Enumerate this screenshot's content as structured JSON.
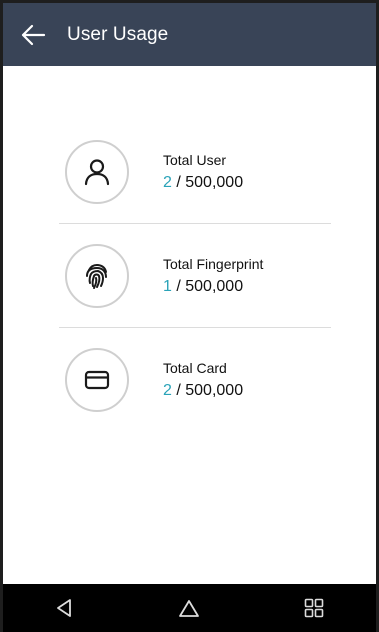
{
  "header": {
    "title": "User Usage",
    "background": "#394457"
  },
  "stats": [
    {
      "label": "Total User",
      "count": "2",
      "separator": " / ",
      "max": "500,000",
      "icon": "person-icon"
    },
    {
      "label": "Total Fingerprint",
      "count": "1",
      "separator": " / ",
      "max": "500,000",
      "icon": "fingerprint-icon"
    },
    {
      "label": "Total Card",
      "count": "2",
      "separator": " / ",
      "max": "500,000",
      "icon": "card-icon"
    }
  ],
  "colors": {
    "accent": "#2aa3b8",
    "navbar": "#000000"
  },
  "navbar": {
    "buttons": [
      "back-nav-icon",
      "home-icon",
      "recent-apps-icon"
    ]
  }
}
